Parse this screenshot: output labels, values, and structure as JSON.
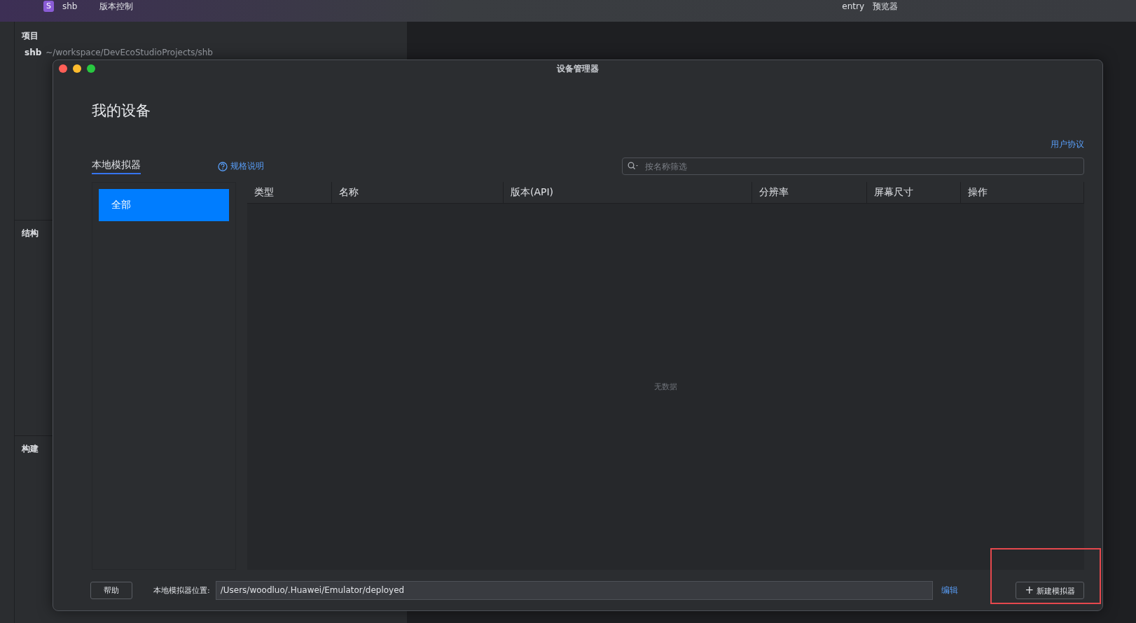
{
  "ide": {
    "project_badge": "S",
    "project_name": "shb",
    "vcs_menu": "版本控制",
    "run_config": "entry",
    "device_target": "预览器",
    "project_panel": {
      "title": "项目",
      "root": "shb",
      "root_path": "~/workspace/DevEcoStudioProjects/shb"
    },
    "structure_panel": {
      "title": "结构"
    },
    "build_panel": {
      "title": "构建"
    }
  },
  "dialog": {
    "title": "设备管理器",
    "heading": "我的设备",
    "agreement_link": "用户协议",
    "tabs": [
      {
        "label": "本地模拟器",
        "selected": true
      }
    ],
    "spec_link": "规格说明",
    "search": {
      "placeholder": "按名称筛选"
    },
    "categories": [
      {
        "label": "全部",
        "selected": true
      }
    ],
    "table": {
      "columns": [
        "类型",
        "名称",
        "版本(API)",
        "分辨率",
        "屏幕尺寸",
        "操作"
      ],
      "empty_text": "无数据"
    },
    "help_button": "帮助",
    "location_label": "本地模拟器位置:",
    "location_value": "/Users/woodluo/.Huawei/Emulator/deployed",
    "edit_link": "编辑",
    "new_button": {
      "icon": "+",
      "label": "新建模拟器",
      "highlighted": true
    }
  }
}
